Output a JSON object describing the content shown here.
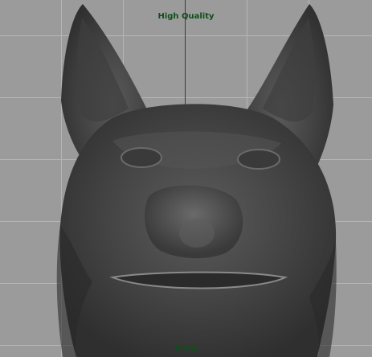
{
  "viewport": {
    "shading_mode": "High Quality",
    "camera_name": "front"
  },
  "colors": {
    "background": "#9b9b9b",
    "grid": "#b6b6b6",
    "axis": "#3a3a3a",
    "label": "#0e4f1c",
    "model_base": "#4a4a4a"
  },
  "scene": {
    "model_icon": "wolf-head-mesh-icon"
  }
}
